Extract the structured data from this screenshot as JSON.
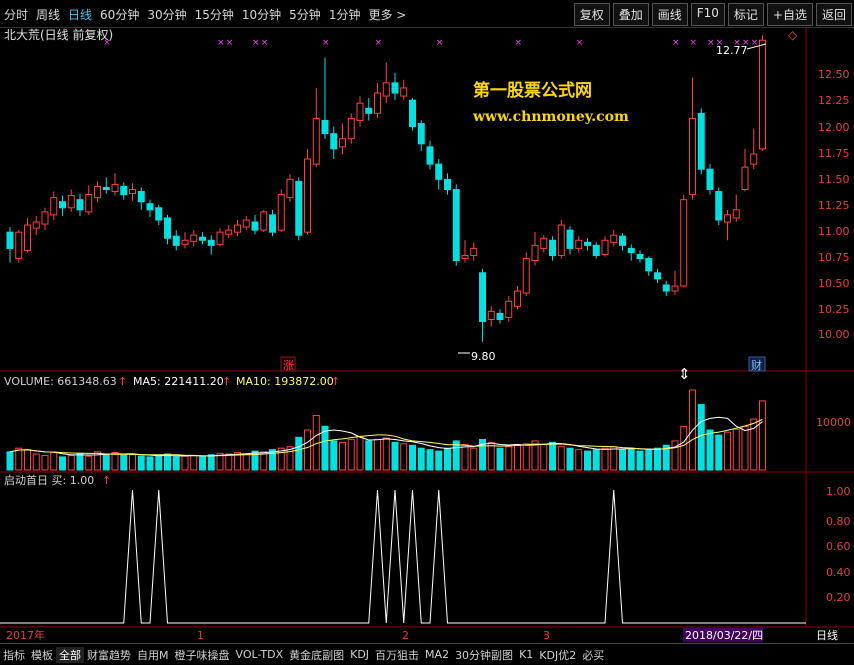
{
  "periods": [
    "分时",
    "周线",
    "日线",
    "60分钟",
    "30分钟",
    "15分钟",
    "10分钟",
    "5分钟",
    "1分钟",
    "更多 >"
  ],
  "active_period": 2,
  "top_buttons": [
    "复权",
    "叠加",
    "画线",
    "F10",
    "标记",
    "+自选",
    "返回"
  ],
  "stock_title": "北大荒(日线 前复权)",
  "watermark": {
    "line1": "第一股票公式网",
    "line2": "www.chnmoney.com"
  },
  "annotations": {
    "high": "12.77",
    "low": "9.80",
    "tag_zhang": "涨",
    "tag_cai": "财"
  },
  "price_axis": [
    "12.50",
    "12.25",
    "12.00",
    "11.75",
    "11.50",
    "11.25",
    "11.00",
    "10.75",
    "10.50",
    "10.25",
    "10.00"
  ],
  "volume_header": {
    "volume": "VOLUME: 661348.63",
    "ma5": "MA5: 221411.20",
    "ma10": "MA10: 193872.00"
  },
  "volume_axis": [
    "10000"
  ],
  "indicator_header": "启动首日 买: 1.00",
  "indicator_axis": [
    "1.00",
    "0.80",
    "0.60",
    "0.40",
    "0.20"
  ],
  "date_axis": {
    "year": "2017年",
    "m1": "1",
    "m2": "2",
    "m3": "3",
    "current": "2018/03/22/四",
    "period": "日线"
  },
  "bottom_tabs": [
    "指标",
    "模板",
    "全部",
    "财富趋势",
    "自用M",
    "橙子味操盘",
    "VOL-TDX",
    "黄金底副图",
    "KDJ",
    "百万狙击",
    "MA2",
    "30分钟副图",
    "K1",
    "KDJ优2",
    "必买"
  ],
  "active_tab": 2,
  "colors": {
    "up": "#ff4040",
    "down": "#00e0e0",
    "ma5": "#ffffff",
    "ma10": "#ffff60",
    "marker": "#ff40ff",
    "watermark": "#ffd700"
  },
  "chart_data": {
    "type": "candlestick",
    "ylim": [
      9.7,
      12.9
    ],
    "candles": [
      [
        10.88,
        10.72,
        10.93,
        10.58
      ],
      [
        10.62,
        10.88,
        10.9,
        10.58
      ],
      [
        10.7,
        10.95,
        11.02,
        10.68
      ],
      [
        10.92,
        10.98,
        11.04,
        10.85
      ],
      [
        10.96,
        11.08,
        11.12,
        10.9
      ],
      [
        11.05,
        11.22,
        11.28,
        11.0
      ],
      [
        11.18,
        11.12,
        11.24,
        11.04
      ],
      [
        11.12,
        11.24,
        11.3,
        11.08
      ],
      [
        11.2,
        11.1,
        11.26,
        11.04
      ],
      [
        11.08,
        11.25,
        11.34,
        11.05
      ],
      [
        11.22,
        11.33,
        11.38,
        11.18
      ],
      [
        11.32,
        11.3,
        11.42,
        11.26
      ],
      [
        11.28,
        11.35,
        11.46,
        11.24
      ],
      [
        11.33,
        11.25,
        11.37,
        11.2
      ],
      [
        11.26,
        11.3,
        11.36,
        11.19
      ],
      [
        11.28,
        11.18,
        11.32,
        11.1
      ],
      [
        11.16,
        11.1,
        11.2,
        11.03
      ],
      [
        11.12,
        11.0,
        11.15,
        10.95
      ],
      [
        11.02,
        10.82,
        11.05,
        10.76
      ],
      [
        10.84,
        10.75,
        10.9,
        10.7
      ],
      [
        10.76,
        10.8,
        10.88,
        10.72
      ],
      [
        10.79,
        10.85,
        10.9,
        10.74
      ],
      [
        10.83,
        10.8,
        10.88,
        10.76
      ],
      [
        10.8,
        10.75,
        10.85,
        10.66
      ],
      [
        10.76,
        10.88,
        10.92,
        10.74
      ],
      [
        10.86,
        10.9,
        10.95,
        10.82
      ],
      [
        10.88,
        10.95,
        11.0,
        10.84
      ],
      [
        10.93,
        11.0,
        11.04,
        10.9
      ],
      [
        10.98,
        10.9,
        11.05,
        10.86
      ],
      [
        10.9,
        11.08,
        11.1,
        10.88
      ],
      [
        11.05,
        10.88,
        11.1,
        10.84
      ],
      [
        10.9,
        11.25,
        11.3,
        10.88
      ],
      [
        11.22,
        11.4,
        11.45,
        11.18
      ],
      [
        11.38,
        10.85,
        11.42,
        10.8
      ],
      [
        10.88,
        11.6,
        11.7,
        10.86
      ],
      [
        11.55,
        12.0,
        12.3,
        11.52
      ],
      [
        11.98,
        11.85,
        12.6,
        11.8
      ],
      [
        11.85,
        11.7,
        11.92,
        11.6
      ],
      [
        11.72,
        11.8,
        11.95,
        11.65
      ],
      [
        11.8,
        12.0,
        12.05,
        11.75
      ],
      [
        11.98,
        12.15,
        12.22,
        11.92
      ],
      [
        12.1,
        12.05,
        12.2,
        11.98
      ],
      [
        12.05,
        12.25,
        12.35,
        12.0
      ],
      [
        12.22,
        12.35,
        12.55,
        12.15
      ],
      [
        12.35,
        12.25,
        12.45,
        12.18
      ],
      [
        12.22,
        12.3,
        12.38,
        12.18
      ],
      [
        12.18,
        11.92,
        12.2,
        11.88
      ],
      [
        11.95,
        11.75,
        11.98,
        11.68
      ],
      [
        11.72,
        11.55,
        11.78,
        11.5
      ],
      [
        11.55,
        11.4,
        11.6,
        11.3
      ],
      [
        11.4,
        11.3,
        11.46,
        11.25
      ],
      [
        11.3,
        10.6,
        11.35,
        10.55
      ],
      [
        10.62,
        10.65,
        10.8,
        10.58
      ],
      [
        10.65,
        10.72,
        10.78,
        10.6
      ],
      [
        10.48,
        10.0,
        10.52,
        9.8
      ],
      [
        10.02,
        10.1,
        10.15,
        9.95
      ],
      [
        10.08,
        10.02,
        10.12,
        9.98
      ],
      [
        10.04,
        10.2,
        10.25,
        10.0
      ],
      [
        10.15,
        10.3,
        10.35,
        10.12
      ],
      [
        10.28,
        10.62,
        10.68,
        10.25
      ],
      [
        10.6,
        10.75,
        10.88,
        10.55
      ],
      [
        10.72,
        10.82,
        10.85,
        10.68
      ],
      [
        10.8,
        10.65,
        10.84,
        10.6
      ],
      [
        10.65,
        10.95,
        11.0,
        10.62
      ],
      [
        10.9,
        10.72,
        10.94,
        10.66
      ],
      [
        10.72,
        10.8,
        10.84,
        10.68
      ],
      [
        10.78,
        10.75,
        10.82,
        10.7
      ],
      [
        10.75,
        10.65,
        10.78,
        10.62
      ],
      [
        10.66,
        10.8,
        10.84,
        10.64
      ],
      [
        10.78,
        10.85,
        10.9,
        10.74
      ],
      [
        10.84,
        10.75,
        10.87,
        10.7
      ],
      [
        10.72,
        10.68,
        10.76,
        10.6
      ],
      [
        10.66,
        10.62,
        10.7,
        10.58
      ],
      [
        10.62,
        10.5,
        10.64,
        10.45
      ],
      [
        10.48,
        10.42,
        10.52,
        10.38
      ],
      [
        10.36,
        10.3,
        10.4,
        10.25
      ],
      [
        10.3,
        10.35,
        10.5,
        10.26
      ],
      [
        10.35,
        11.2,
        11.25,
        10.34
      ],
      [
        11.25,
        12.0,
        12.4,
        11.2
      ],
      [
        12.05,
        11.5,
        12.1,
        11.45
      ],
      [
        11.5,
        11.3,
        11.55,
        11.25
      ],
      [
        11.28,
        11.0,
        11.32,
        10.95
      ],
      [
        10.98,
        11.05,
        11.1,
        10.8
      ],
      [
        11.02,
        11.1,
        11.25,
        10.98
      ],
      [
        11.3,
        11.52,
        11.7,
        11.28
      ],
      [
        11.55,
        11.65,
        11.9,
        11.5
      ],
      [
        11.7,
        12.77,
        12.82,
        11.68
      ]
    ],
    "volumes": [
      25,
      30,
      28,
      22,
      20,
      24,
      18,
      20,
      22,
      19,
      25,
      22,
      24,
      20,
      21,
      19,
      18,
      20,
      22,
      18,
      19,
      20,
      18,
      21,
      23,
      22,
      24,
      22,
      26,
      25,
      28,
      30,
      32,
      45,
      55,
      75,
      60,
      40,
      38,
      42,
      46,
      40,
      42,
      44,
      38,
      36,
      34,
      30,
      28,
      26,
      30,
      40,
      35,
      30,
      42,
      38,
      30,
      32,
      34,
      36,
      40,
      35,
      38,
      32,
      30,
      28,
      26,
      28,
      30,
      32,
      28,
      30,
      26,
      28,
      30,
      34,
      40,
      60,
      110,
      90,
      55,
      48,
      52,
      56,
      60,
      70,
      95
    ],
    "buy_signal_indices": [
      14,
      17,
      42,
      44,
      46,
      49,
      69
    ],
    "pink_markers": [
      11,
      24,
      25,
      28,
      29,
      36,
      42,
      49,
      58,
      65,
      76,
      78,
      80,
      81,
      83,
      84,
      85,
      86
    ]
  }
}
